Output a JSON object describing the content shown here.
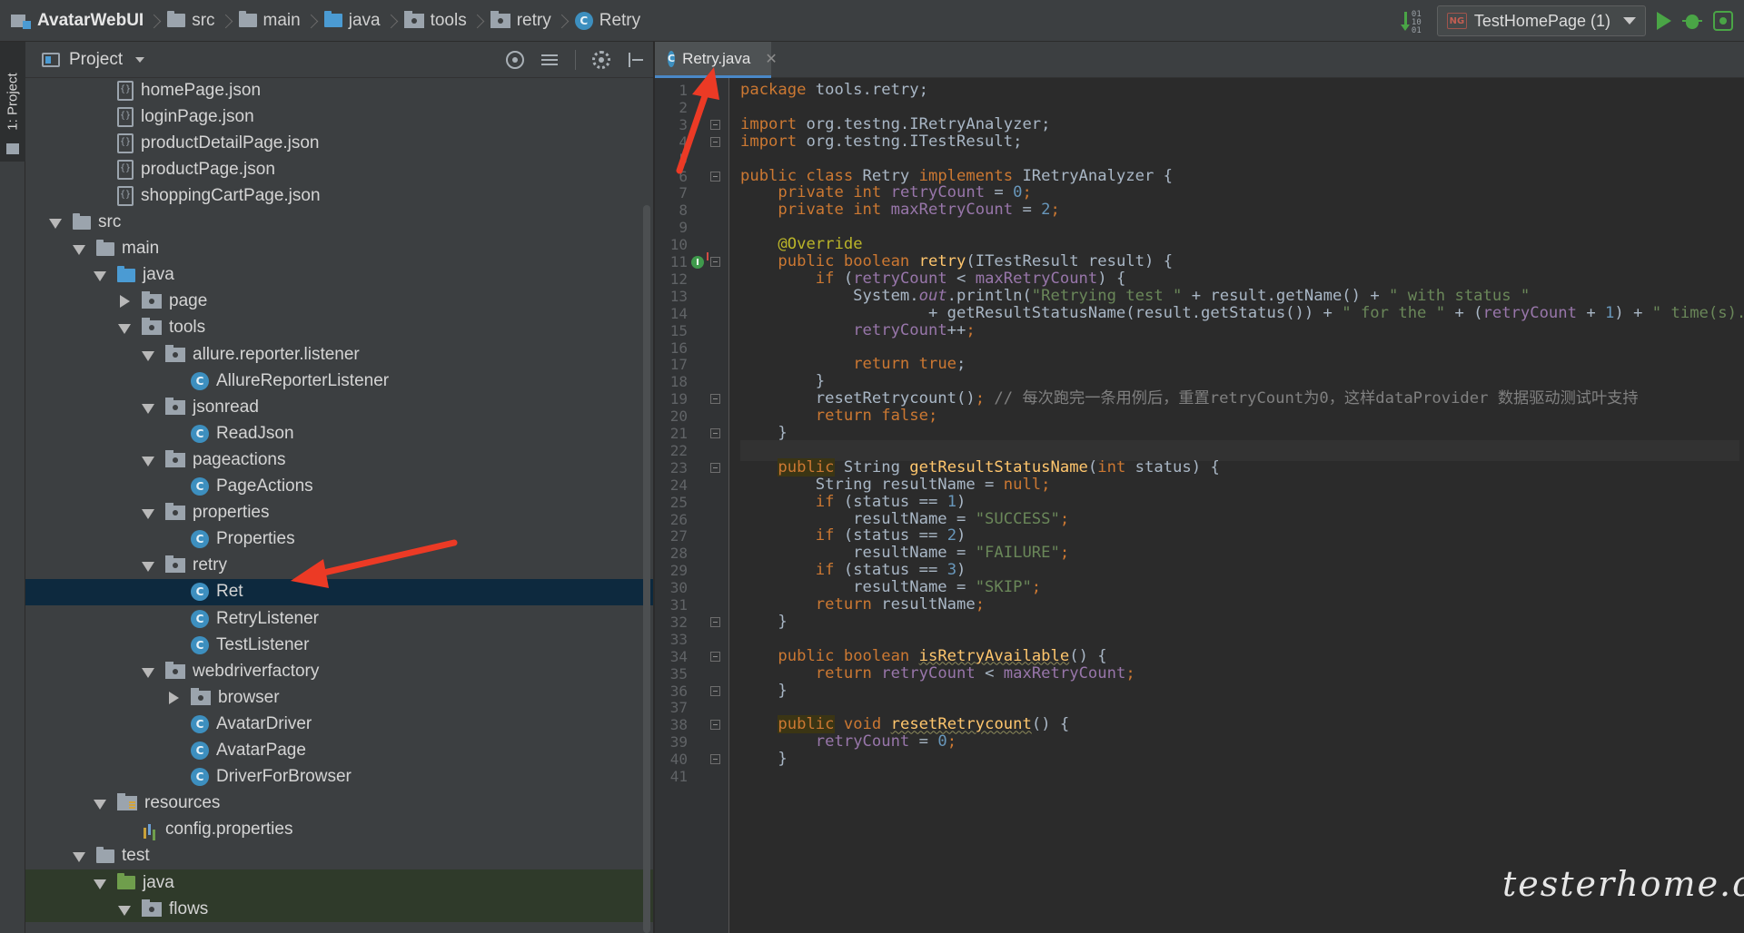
{
  "breadcrumb": [
    {
      "label": "AvatarWebUI",
      "icon": "module-icon",
      "bold": true
    },
    {
      "label": "src",
      "icon": "folder-icon"
    },
    {
      "label": "main",
      "icon": "folder-icon"
    },
    {
      "label": "java",
      "icon": "source-folder-icon"
    },
    {
      "label": "tools",
      "icon": "package-icon"
    },
    {
      "label": "retry",
      "icon": "package-icon"
    },
    {
      "label": "Retry",
      "icon": "class-icon"
    }
  ],
  "run_config": {
    "label": "TestHomePage (1)",
    "icon_text": "NG"
  },
  "tool_window_tab": "1: Project",
  "project_panel": {
    "title": "Project",
    "tree": [
      {
        "label": "homePage.json",
        "icon": "json",
        "depth": 3,
        "twisty": "none"
      },
      {
        "label": "loginPage.json",
        "icon": "json",
        "depth": 3,
        "twisty": "none"
      },
      {
        "label": "productDetailPage.json",
        "icon": "json",
        "depth": 3,
        "twisty": "none"
      },
      {
        "label": "productPage.json",
        "icon": "json",
        "depth": 3,
        "twisty": "none"
      },
      {
        "label": "shoppingCartPage.json",
        "icon": "json",
        "depth": 3,
        "twisty": "none"
      },
      {
        "label": "src",
        "icon": "folder",
        "depth": 1,
        "twisty": "open"
      },
      {
        "label": "main",
        "icon": "folder",
        "depth": 2,
        "twisty": "open"
      },
      {
        "label": "java",
        "icon": "folder-blue",
        "depth": 3,
        "twisty": "open"
      },
      {
        "label": "page",
        "icon": "package",
        "depth": 4,
        "twisty": "closed"
      },
      {
        "label": "tools",
        "icon": "package",
        "depth": 4,
        "twisty": "open"
      },
      {
        "label": "allure.reporter.listener",
        "icon": "package",
        "depth": 5,
        "twisty": "open"
      },
      {
        "label": "AllureReporterListener",
        "icon": "class",
        "depth": 6,
        "twisty": "none"
      },
      {
        "label": "jsonread",
        "icon": "package",
        "depth": 5,
        "twisty": "open"
      },
      {
        "label": "ReadJson",
        "icon": "class",
        "depth": 6,
        "twisty": "none"
      },
      {
        "label": "pageactions",
        "icon": "package",
        "depth": 5,
        "twisty": "open"
      },
      {
        "label": "PageActions",
        "icon": "class",
        "depth": 6,
        "twisty": "none"
      },
      {
        "label": "properties",
        "icon": "package",
        "depth": 5,
        "twisty": "open"
      },
      {
        "label": "Properties",
        "icon": "class",
        "depth": 6,
        "twisty": "none"
      },
      {
        "label": "retry",
        "icon": "package",
        "depth": 5,
        "twisty": "open"
      },
      {
        "label": "Ret",
        "icon": "class",
        "depth": 6,
        "twisty": "none",
        "selected": true
      },
      {
        "label": "RetryListener",
        "icon": "class",
        "depth": 6,
        "twisty": "none"
      },
      {
        "label": "TestListener",
        "icon": "class",
        "depth": 6,
        "twisty": "none"
      },
      {
        "label": "webdriverfactory",
        "icon": "package",
        "depth": 5,
        "twisty": "open"
      },
      {
        "label": "browser",
        "icon": "package",
        "depth": 6,
        "twisty": "closed"
      },
      {
        "label": "AvatarDriver",
        "icon": "class",
        "depth": 6,
        "twisty": "none"
      },
      {
        "label": "AvatarPage",
        "icon": "class",
        "depth": 6,
        "twisty": "none"
      },
      {
        "label": "DriverForBrowser",
        "icon": "class",
        "depth": 6,
        "twisty": "none"
      },
      {
        "label": "resources",
        "icon": "resources",
        "depth": 3,
        "twisty": "open"
      },
      {
        "label": "config.properties",
        "icon": "properties",
        "depth": 4,
        "twisty": "none"
      },
      {
        "label": "test",
        "icon": "folder",
        "depth": 2,
        "twisty": "open"
      },
      {
        "label": "java",
        "icon": "folder-green",
        "depth": 3,
        "twisty": "open",
        "test_zone": true
      },
      {
        "label": "flows",
        "icon": "package",
        "depth": 4,
        "twisty": "open",
        "test_zone": true
      }
    ]
  },
  "editor": {
    "tab_label": "Retry.java",
    "caret_line": 22,
    "lines": [
      [
        [
          "kw",
          "package"
        ],
        [
          "p",
          " tools.retry;"
        ]
      ],
      [],
      [
        [
          "kw",
          "import"
        ],
        [
          "p",
          " org.testng.IRetryAnalyzer;"
        ]
      ],
      [
        [
          "kw",
          "import"
        ],
        [
          "p",
          " org.testng.ITestResult;"
        ]
      ],
      [],
      [
        [
          "kw",
          "public class"
        ],
        [
          "p",
          " Retry "
        ],
        [
          "kw",
          "implements"
        ],
        [
          "p",
          " IRetryAnalyzer {"
        ]
      ],
      [
        [
          "p",
          "    "
        ],
        [
          "kw",
          "private int"
        ],
        [
          "p",
          " "
        ],
        [
          "fld",
          "retryCount"
        ],
        [
          "p",
          " = "
        ],
        [
          "num",
          "0"
        ],
        [
          "kw",
          ";"
        ]
      ],
      [
        [
          "p",
          "    "
        ],
        [
          "kw",
          "private int"
        ],
        [
          "p",
          " "
        ],
        [
          "fld",
          "maxRetryCount"
        ],
        [
          "p",
          " = "
        ],
        [
          "num",
          "2"
        ],
        [
          "kw",
          ";"
        ]
      ],
      [],
      [
        [
          "p",
          "    "
        ],
        [
          "ann",
          "@Override"
        ]
      ],
      [
        [
          "p",
          "    "
        ],
        [
          "kw",
          "public boolean"
        ],
        [
          "p",
          " "
        ],
        [
          "fn",
          "retry"
        ],
        [
          "p",
          "(ITestResult result) {"
        ]
      ],
      [
        [
          "p",
          "        "
        ],
        [
          "kw",
          "if"
        ],
        [
          "p",
          " ("
        ],
        [
          "fld",
          "retryCount"
        ],
        [
          "p",
          " < "
        ],
        [
          "fld",
          "maxRetryCount"
        ],
        [
          "p",
          ") {"
        ]
      ],
      [
        [
          "p",
          "            System."
        ],
        [
          "fld-i",
          "out"
        ],
        [
          "p",
          ".println("
        ],
        [
          "str",
          "\"Retrying test \""
        ],
        [
          "p",
          " + result.getName() + "
        ],
        [
          "str",
          "\" with status \""
        ]
      ],
      [
        [
          "p",
          "                    + getResultStatusName(result.getStatus()) + "
        ],
        [
          "str",
          "\" for the \""
        ],
        [
          "p",
          " + ("
        ],
        [
          "fld",
          "retryCount"
        ],
        [
          "p",
          " + "
        ],
        [
          "num",
          "1"
        ],
        [
          "p",
          ") + "
        ],
        [
          "str",
          "\" time(s).\""
        ],
        [
          "p",
          ");"
        ]
      ],
      [
        [
          "p",
          "            "
        ],
        [
          "fld",
          "retryCount"
        ],
        [
          "p",
          "++"
        ],
        [
          "kw",
          ";"
        ]
      ],
      [],
      [
        [
          "p",
          "            "
        ],
        [
          "kw",
          "return true"
        ],
        [
          "p",
          ";"
        ]
      ],
      [
        [
          "p",
          "        }"
        ]
      ],
      [
        [
          "p",
          "        resetRetrycount()"
        ],
        [
          "kw",
          ";"
        ],
        [
          "p",
          " "
        ],
        [
          "cmt",
          "// 每次跑完一条用例后，重置retryCount为0，这样dataProvider 数据驱动测试叶支持"
        ]
      ],
      [
        [
          "p",
          "        "
        ],
        [
          "kw",
          "return false"
        ],
        [
          "kw",
          ";"
        ]
      ],
      [
        [
          "p",
          "    }"
        ]
      ],
      [],
      [
        [
          "p",
          "    "
        ],
        [
          "kw-hl",
          "public"
        ],
        [
          "p",
          " String "
        ],
        [
          "fn",
          "getResultStatusName"
        ],
        [
          "p",
          "("
        ],
        [
          "kw",
          "int"
        ],
        [
          "p",
          " status) {"
        ]
      ],
      [
        [
          "p",
          "        String resultName = "
        ],
        [
          "kw",
          "null"
        ],
        [
          "kw",
          ";"
        ]
      ],
      [
        [
          "p",
          "        "
        ],
        [
          "kw",
          "if"
        ],
        [
          "p",
          " (status == "
        ],
        [
          "num",
          "1"
        ],
        [
          "p",
          ")"
        ]
      ],
      [
        [
          "p",
          "            resultName = "
        ],
        [
          "str",
          "\"SUCCESS\""
        ],
        [
          "kw",
          ";"
        ]
      ],
      [
        [
          "p",
          "        "
        ],
        [
          "kw",
          "if"
        ],
        [
          "p",
          " (status == "
        ],
        [
          "num",
          "2"
        ],
        [
          "p",
          ")"
        ]
      ],
      [
        [
          "p",
          "            resultName = "
        ],
        [
          "str",
          "\"FAILURE\""
        ],
        [
          "kw",
          ";"
        ]
      ],
      [
        [
          "p",
          "        "
        ],
        [
          "kw",
          "if"
        ],
        [
          "p",
          " (status == "
        ],
        [
          "num",
          "3"
        ],
        [
          "p",
          ")"
        ]
      ],
      [
        [
          "p",
          "            resultName = "
        ],
        [
          "str",
          "\"SKIP\""
        ],
        [
          "kw",
          ";"
        ]
      ],
      [
        [
          "p",
          "        "
        ],
        [
          "kw",
          "return"
        ],
        [
          "p",
          " resultName"
        ],
        [
          "kw",
          ";"
        ]
      ],
      [
        [
          "p",
          "    }"
        ]
      ],
      [],
      [
        [
          "p",
          "    "
        ],
        [
          "kw",
          "public boolean"
        ],
        [
          "p",
          " "
        ],
        [
          "fn-warn",
          "isRetryAvailable"
        ],
        [
          "p",
          "() {"
        ]
      ],
      [
        [
          "p",
          "        "
        ],
        [
          "kw",
          "return"
        ],
        [
          "p",
          " "
        ],
        [
          "fld",
          "retryCount"
        ],
        [
          "p",
          " < "
        ],
        [
          "fld",
          "maxRetryCount"
        ],
        [
          "kw",
          ";"
        ]
      ],
      [
        [
          "p",
          "    }"
        ]
      ],
      [],
      [
        [
          "p",
          "    "
        ],
        [
          "kw-hl",
          "public"
        ],
        [
          "p",
          " "
        ],
        [
          "kw",
          "void"
        ],
        [
          "p",
          " "
        ],
        [
          "fn-warn",
          "resetRetrycount"
        ],
        [
          "p",
          "() {"
        ]
      ],
      [
        [
          "p",
          "        "
        ],
        [
          "fld",
          "retryCount"
        ],
        [
          "p",
          " = "
        ],
        [
          "num",
          "0"
        ],
        [
          "kw",
          ";"
        ]
      ],
      [
        [
          "p",
          "    }"
        ]
      ],
      []
    ],
    "fold_lines": [
      3,
      4,
      6,
      11,
      19,
      21,
      23,
      32,
      34,
      36,
      38,
      40
    ],
    "override_line": 11
  },
  "watermark": "testerhome.com"
}
